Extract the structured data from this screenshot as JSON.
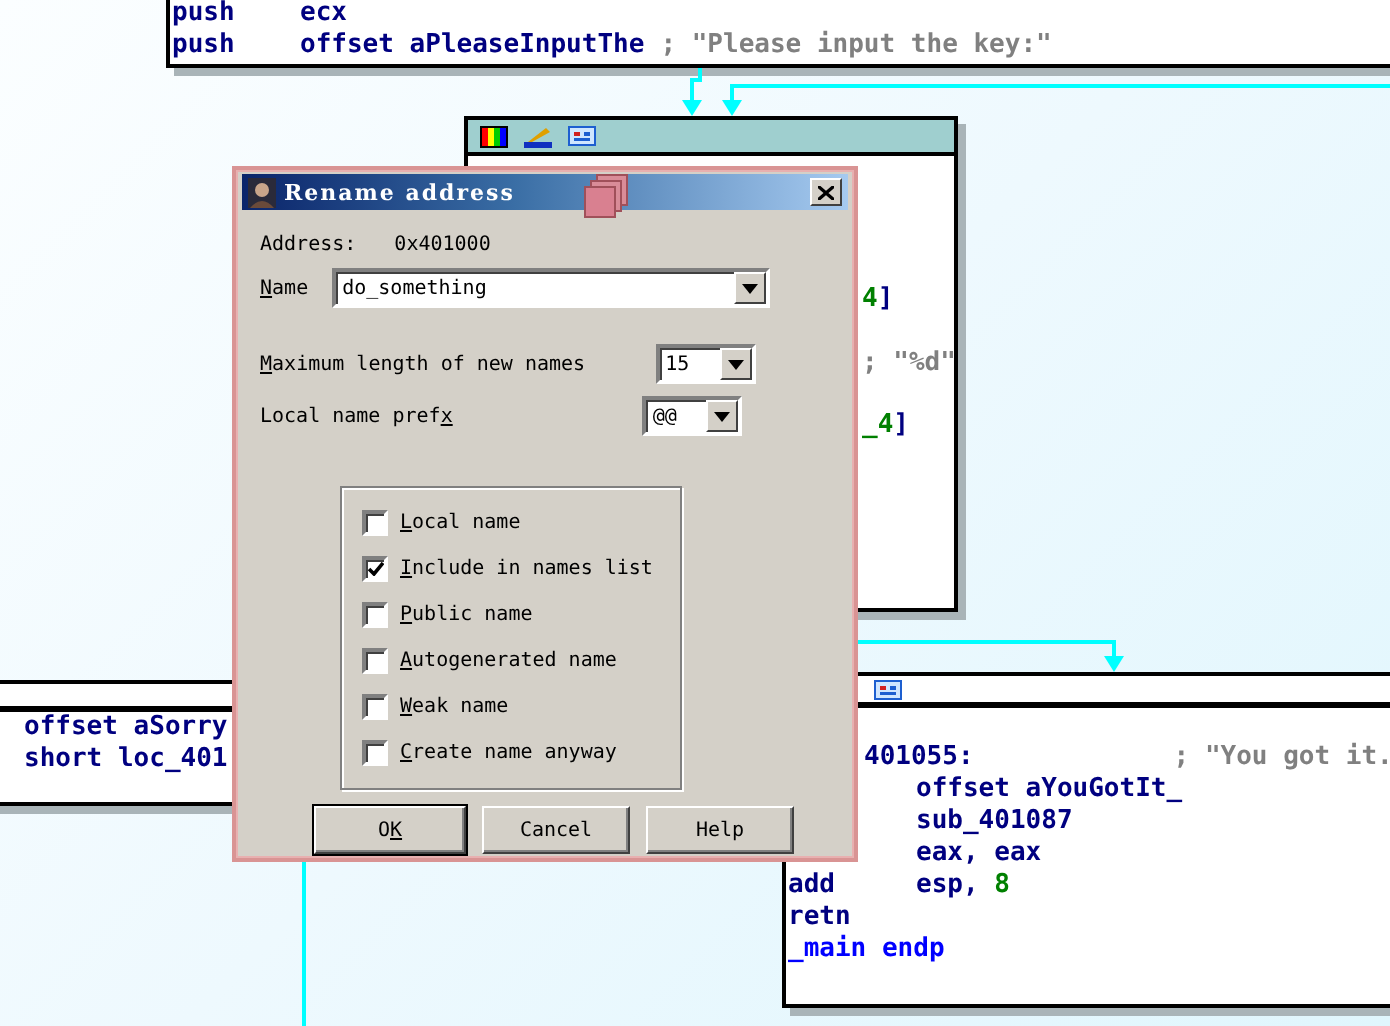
{
  "graph": {
    "nodes": [
      {
        "kind": "bare",
        "lines": [
          {
            "kind": "instr",
            "mnemonic": "push",
            "operands": [
              {
                "text": "ecx",
                "kind": "operand"
              }
            ]
          },
          {
            "kind": "instr",
            "mnemonic": "push",
            "operands": [
              {
                "text": "offset aPleaseInputThe",
                "kind": "operand"
              }
            ],
            "comment": "; \"Please input the key:\""
          }
        ]
      },
      {
        "kind": "toolbar",
        "lines": [
          {
            "kind": "fragment",
            "parts": [
              {
                "text": "4",
                "kind": "number"
              },
              {
                "text": "]",
                "kind": "operand"
              }
            ]
          },
          {
            "kind": "fragment",
            "parts": [
              {
                "text": "; \"%d\"",
                "kind": "comment"
              }
            ]
          },
          {
            "kind": "fragment",
            "parts": [
              {
                "text": "_4",
                "kind": "number"
              },
              {
                "text": "]",
                "kind": "operand"
              }
            ]
          }
        ]
      },
      {
        "kind": "plain",
        "lines": [
          {
            "kind": "instr",
            "operands": [
              {
                "text": "offset aSorry",
                "kind": "operand"
              }
            ]
          },
          {
            "kind": "instr",
            "operands": [
              {
                "text": "short loc_401",
                "kind": "operand"
              }
            ]
          }
        ]
      },
      {
        "kind": "partial",
        "lines": [
          {
            "kind": "label",
            "label": "401055:",
            "comment": "; \"You got it."
          },
          {
            "kind": "instr",
            "operands": [
              {
                "text": "offset aYouGotIt_",
                "kind": "operand"
              }
            ]
          },
          {
            "kind": "instr",
            "operands": [
              {
                "text": "sub_401087",
                "kind": "operand"
              }
            ]
          },
          {
            "kind": "instr",
            "operands": [
              {
                "text": "eax, eax",
                "kind": "operand"
              }
            ]
          },
          {
            "kind": "instr",
            "mnemonic": "add",
            "operands": [
              {
                "text": "esp, ",
                "kind": "operand"
              },
              {
                "text": "8",
                "kind": "number"
              }
            ]
          },
          {
            "kind": "instr",
            "mnemonic": "retn"
          },
          {
            "kind": "directive",
            "text": "_main endp"
          }
        ]
      }
    ]
  },
  "dialog": {
    "title": "Rename address",
    "address_label": "Address:",
    "address": "0x401000",
    "name_label": {
      "key": "N",
      "post": "ame"
    },
    "name_value": "do_something",
    "max_length_label": {
      "key": "M",
      "post": "aximum length of new names"
    },
    "max_length": "15",
    "prefix_label": {
      "pre": "Local name pref",
      "key": "x"
    },
    "prefix": "@@",
    "options": [
      {
        "label": {
          "key": "L",
          "post": "ocal name"
        },
        "checked": false
      },
      {
        "label": {
          "key": "I",
          "post": "nclude in names list"
        },
        "checked": true
      },
      {
        "label": {
          "key": "P",
          "post": "ublic name"
        },
        "checked": false
      },
      {
        "label": {
          "key": "A",
          "post": "utogenerated name"
        },
        "checked": false
      },
      {
        "label": {
          "key": "W",
          "post": "eak name"
        },
        "checked": false
      },
      {
        "label": {
          "key": "C",
          "post": "reate name anyway"
        },
        "checked": false
      }
    ],
    "buttons": [
      {
        "label": {
          "pre": "O",
          "key": "K"
        },
        "default": true
      },
      {
        "label": {
          "pre": "Cancel"
        },
        "default": false
      },
      {
        "label": {
          "pre": "Help"
        },
        "default": false
      }
    ]
  }
}
